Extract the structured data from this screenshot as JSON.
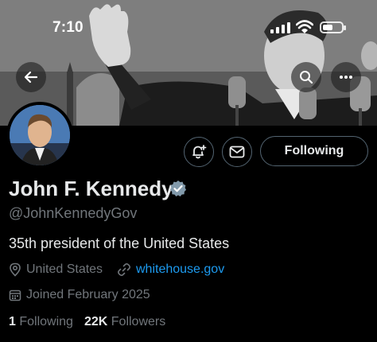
{
  "status_bar": {
    "time": "7:10"
  },
  "banner": {
    "description_icon": "podium-photo"
  },
  "header_actions": {
    "back_icon": "arrow-left-icon",
    "search_icon": "search-icon",
    "more_icon": "more-icon"
  },
  "profile": {
    "name": "John F. Kennedy",
    "handle": "@JohnKennedyGov",
    "bio": "35th president of the United States",
    "location": "United States",
    "website": "whitehouse.gov",
    "joined": "Joined February 2025",
    "following_count": "1",
    "following_label": "Following",
    "followers_count": "22K",
    "followers_label": "Followers",
    "verified_color": "#829aab"
  },
  "actions": {
    "follow_label": "Following"
  },
  "colors": {
    "background": "#000000",
    "text_primary": "#e7e9ea",
    "text_secondary": "#71767b",
    "link": "#1d9bf0",
    "border": "#536471"
  }
}
